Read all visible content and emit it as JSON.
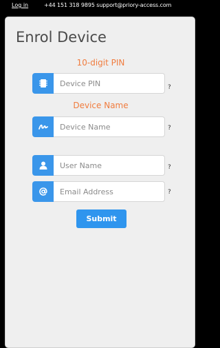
{
  "topbar": {
    "login_label": "Log in",
    "contact_text": "+44 151 318 9895 support@priory-access.com"
  },
  "page": {
    "title": "Enrol Device"
  },
  "form": {
    "pin_label": "10-digit PIN",
    "device_name_label": "Device Name",
    "fields": [
      {
        "icon": "chip-icon",
        "placeholder": "Device PIN",
        "help": "?"
      },
      {
        "icon": "signature-icon",
        "placeholder": "Device Name",
        "help": "?"
      },
      {
        "icon": "user-icon",
        "placeholder": "User Name",
        "help": "?"
      },
      {
        "icon": "at-icon",
        "placeholder": "Email Address",
        "help": "?"
      }
    ],
    "submit_label": "Submit"
  },
  "colors": {
    "accent": "#3a96ea",
    "label_orange": "#f07c3e",
    "background": "#efefef"
  }
}
